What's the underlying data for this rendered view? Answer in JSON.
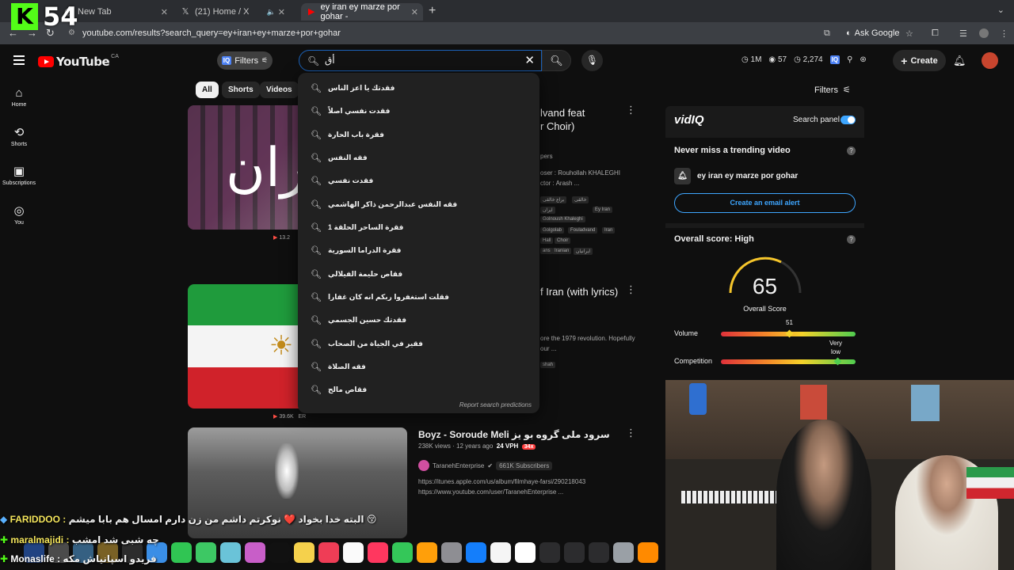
{
  "browser": {
    "overlay_counter": "54",
    "tabs": [
      {
        "title": "New Tab"
      },
      {
        "title": "(21) Home / X"
      },
      {
        "title": "ey iran ey marze por gohar -"
      }
    ],
    "url": "youtube.com/results?search_query=ey+iran+ey+marze+por+gohar",
    "ask_google": "Ask Google"
  },
  "masthead": {
    "logo_text": "YouTube",
    "country": "CA",
    "filters_label": "Filters",
    "search_value": "أق",
    "stats": [
      "1M",
      "57",
      "2,274"
    ],
    "create_label": "Create"
  },
  "rail": [
    {
      "label": "Home",
      "icon": "home-icon"
    },
    {
      "label": "Shorts",
      "icon": "shorts-icon"
    },
    {
      "label": "Subscriptions",
      "icon": "subscriptions-icon"
    },
    {
      "label": "You",
      "icon": "you-icon"
    }
  ],
  "chips": [
    "All",
    "Shorts",
    "Videos"
  ],
  "suggestions": [
    "فقدتك يا اعز الناس",
    "فقدت نفسي اصلاً",
    "فقرة باب الحارة",
    "فقه النفس",
    "فقدت نفسي",
    "فقه النفس عبدالرحمن ذاكر الهاشمي",
    "فقرة الساحر الحلقة 1",
    "فقرة الدراما السورية",
    "فقاص حليمة الفيلالي",
    "فقلت استغفروا ربكم انه كان غفارا",
    "فقدتك حسين الجسمي",
    "فقير في الجياة من الصحاب",
    "فقه الصلاة",
    "فقاص مالح"
  ],
  "report_predictions": "Report search predictions",
  "videos": [
    {
      "title_partial": "lvand feat",
      "title_partial2": "r Choir)",
      "meta_partial": "pers",
      "desc1": "oser : Rouhollah KHALEGHI",
      "desc2": "ctor : Arash ...",
      "stats": "13.2",
      "tags": [
        "بر‌اع خالقی",
        "خالقی",
        "ایران",
        "Ey Iran",
        "Golnoush Khaleghi",
        "Golgolab",
        "Fouladvand",
        "Iran",
        "Hall",
        "Choir",
        "ans",
        "Iranian",
        "ایرانیان"
      ]
    },
    {
      "title_partial": "f Iran (with lyrics)",
      "desc1": "ore the 1979 revolution. Hopefully",
      "desc2": "our ...",
      "tag": "shah",
      "stats_views": "39.6K",
      "stats_er": "ER"
    },
    {
      "title": "Boyz - Soroude Meli سرود ملی گروه بو یز",
      "views": "238K views",
      "age": "12 years ago",
      "vph": "24 VPH",
      "multiplier": "34x",
      "channel": "TaranehEnterprise",
      "subs": "661K Subscribers",
      "link1": "https://itunes.apple.com/us/album/filmhaye-farsi/290218043",
      "link2": "https://www.youtube.com/user/TaranehEnterprise ..."
    }
  ],
  "vidiq": {
    "panel_filters": "Filters",
    "logo": "vidIQ",
    "search_panel": "Search panel",
    "trending_title": "Never miss a trending video",
    "alert_query": "ey iran ey marze por gohar",
    "email_btn": "Create an email alert",
    "score_title": "Overall score: High",
    "score": "65",
    "score_label": "Overall Score",
    "volume_label": "Volume",
    "volume_value": "51",
    "competition_label": "Competition",
    "competition_value": "Very low"
  },
  "chat": [
    {
      "name": "FARIDDOO :",
      "msg": "البته خدا بخواد ❤️ نوکرتم داشم من زن دارم امسال هم بابا میشم 😚"
    },
    {
      "name": "maralmajidi :",
      "msg": "چه شبی شد امشب"
    },
    {
      "name": "Monaslife :",
      "msg": "فریدو اسپانیاش مکه"
    }
  ],
  "colors": {
    "accent": "#3ea6ff",
    "brand": "#ff0000",
    "kick": "#53fc18"
  }
}
